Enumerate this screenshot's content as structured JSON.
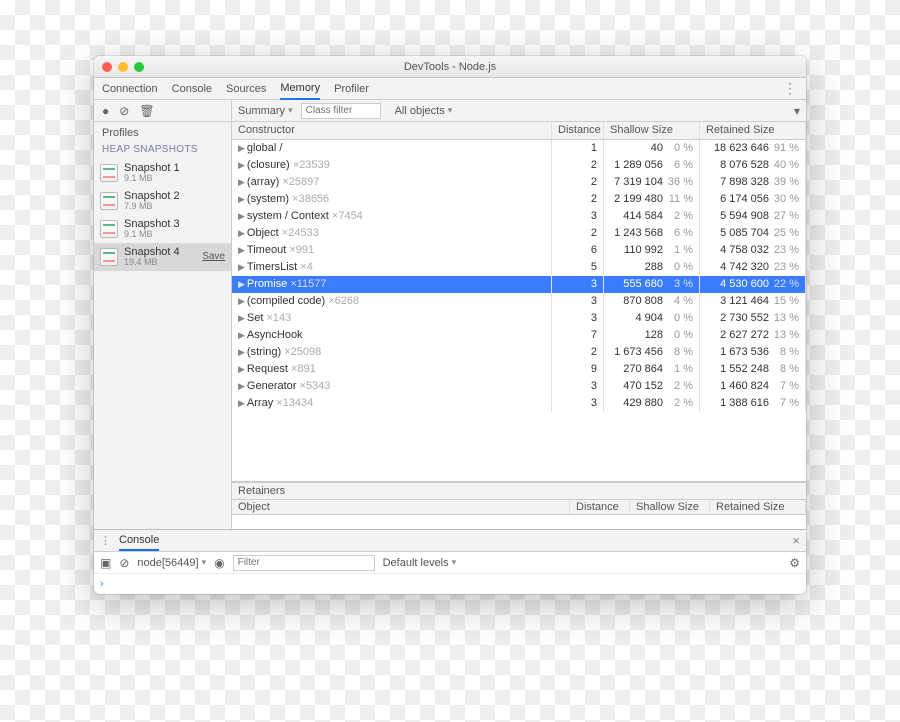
{
  "window": {
    "title": "DevTools - Node.js"
  },
  "tabs": [
    "Connection",
    "Console",
    "Sources",
    "Memory",
    "Profiler"
  ],
  "active_tab": "Memory",
  "sidebar": {
    "section": "Profiles",
    "subsection": "HEAP SNAPSHOTS",
    "snapshots": [
      {
        "name": "Snapshot 1",
        "size": "9.1 MB",
        "selected": false
      },
      {
        "name": "Snapshot 2",
        "size": "7.9 MB",
        "selected": false
      },
      {
        "name": "Snapshot 3",
        "size": "9.1 MB",
        "selected": false
      },
      {
        "name": "Snapshot 4",
        "size": "19.4 MB",
        "selected": true,
        "save_label": "Save"
      }
    ]
  },
  "content_toolbar": {
    "view": "Summary",
    "class_filter_placeholder": "Class filter",
    "scope": "All objects"
  },
  "table": {
    "headers": [
      "Constructor",
      "Distance",
      "Shallow Size",
      "Retained Size"
    ],
    "rows": [
      {
        "name": "global /",
        "count": "",
        "distance": "1",
        "shallow": "40",
        "shallow_pct": "0 %",
        "retained": "18 623 646",
        "retained_pct": "91 %"
      },
      {
        "name": "(closure)",
        "count": "×23539",
        "distance": "2",
        "shallow": "1 289 056",
        "shallow_pct": "6 %",
        "retained": "8 076 528",
        "retained_pct": "40 %"
      },
      {
        "name": "(array)",
        "count": "×25897",
        "distance": "2",
        "shallow": "7 319 104",
        "shallow_pct": "36 %",
        "retained": "7 898 328",
        "retained_pct": "39 %"
      },
      {
        "name": "(system)",
        "count": "×38656",
        "distance": "2",
        "shallow": "2 199 480",
        "shallow_pct": "11 %",
        "retained": "6 174 056",
        "retained_pct": "30 %"
      },
      {
        "name": "system / Context",
        "count": "×7454",
        "distance": "3",
        "shallow": "414 584",
        "shallow_pct": "2 %",
        "retained": "5 594 908",
        "retained_pct": "27 %"
      },
      {
        "name": "Object",
        "count": "×24533",
        "distance": "2",
        "shallow": "1 243 568",
        "shallow_pct": "6 %",
        "retained": "5 085 704",
        "retained_pct": "25 %"
      },
      {
        "name": "Timeout",
        "count": "×991",
        "distance": "6",
        "shallow": "110 992",
        "shallow_pct": "1 %",
        "retained": "4 758 032",
        "retained_pct": "23 %"
      },
      {
        "name": "TimersList",
        "count": "×4",
        "distance": "5",
        "shallow": "288",
        "shallow_pct": "0 %",
        "retained": "4 742 320",
        "retained_pct": "23 %"
      },
      {
        "name": "Promise",
        "count": "×11577",
        "distance": "3",
        "shallow": "555 680",
        "shallow_pct": "3 %",
        "retained": "4 530 600",
        "retained_pct": "22 %",
        "selected": true
      },
      {
        "name": "(compiled code)",
        "count": "×6268",
        "distance": "3",
        "shallow": "870 808",
        "shallow_pct": "4 %",
        "retained": "3 121 464",
        "retained_pct": "15 %"
      },
      {
        "name": "Set",
        "count": "×143",
        "distance": "3",
        "shallow": "4 904",
        "shallow_pct": "0 %",
        "retained": "2 730 552",
        "retained_pct": "13 %"
      },
      {
        "name": "AsyncHook",
        "count": "",
        "distance": "7",
        "shallow": "128",
        "shallow_pct": "0 %",
        "retained": "2 627 272",
        "retained_pct": "13 %"
      },
      {
        "name": "(string)",
        "count": "×25098",
        "distance": "2",
        "shallow": "1 673 456",
        "shallow_pct": "8 %",
        "retained": "1 673 536",
        "retained_pct": "8 %"
      },
      {
        "name": "Request",
        "count": "×891",
        "distance": "9",
        "shallow": "270 864",
        "shallow_pct": "1 %",
        "retained": "1 552 248",
        "retained_pct": "8 %"
      },
      {
        "name": "Generator",
        "count": "×5343",
        "distance": "3",
        "shallow": "470 152",
        "shallow_pct": "2 %",
        "retained": "1 460 824",
        "retained_pct": "7 %"
      },
      {
        "name": "Array",
        "count": "×13434",
        "distance": "3",
        "shallow": "429 880",
        "shallow_pct": "2 %",
        "retained": "1 388 616",
        "retained_pct": "7 %"
      }
    ]
  },
  "retainers": {
    "title": "Retainers",
    "headers": [
      "Object",
      "Distance",
      "Shallow Size",
      "Retained Size"
    ]
  },
  "console": {
    "tab": "Console",
    "context": "node[56449]",
    "filter_placeholder": "Filter",
    "levels": "Default levels",
    "prompt": "›"
  }
}
